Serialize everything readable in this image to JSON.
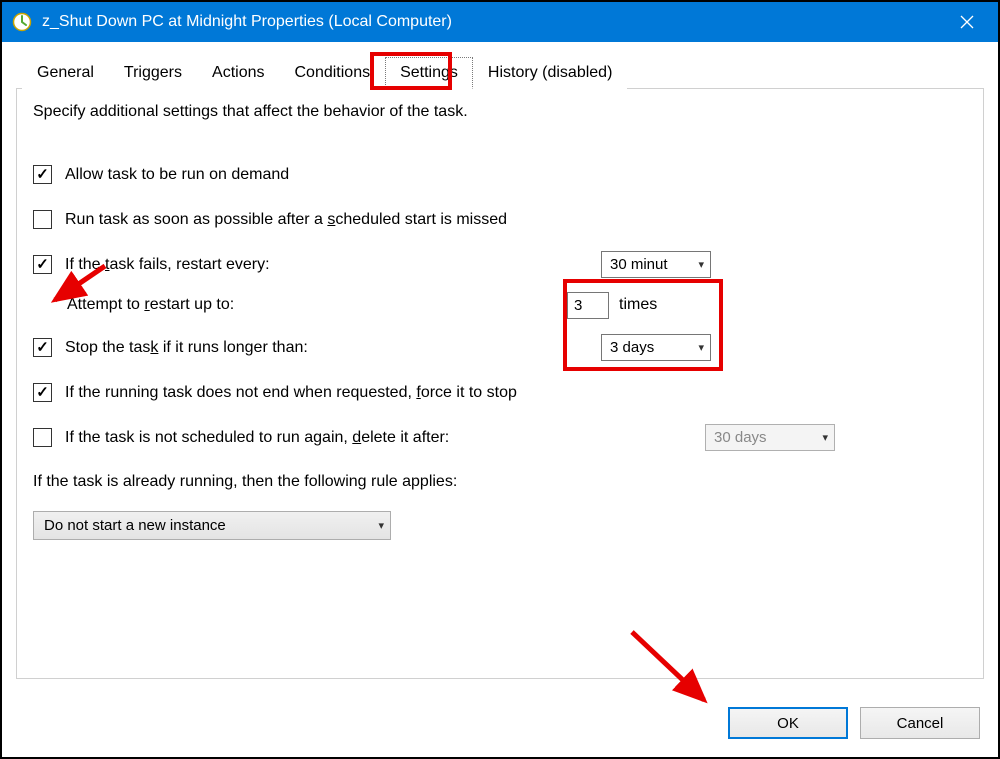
{
  "window": {
    "title": "z_Shut Down PC at Midnight Properties (Local Computer)"
  },
  "tabs": {
    "general": "General",
    "triggers": "Triggers",
    "actions": "Actions",
    "conditions": "Conditions",
    "settings": "Settings",
    "history": "History (disabled)"
  },
  "content": {
    "intro": "Specify additional settings that affect the behavior of the task.",
    "allow_demand": "Allow task to be run on demand",
    "run_missed_pre": "Run task as soon as possible after a ",
    "run_missed_ul": "s",
    "run_missed_post": "cheduled start is missed",
    "restart_pre": "If the ",
    "restart_ul": "t",
    "restart_post": "ask fails, restart every:",
    "restart_interval": "30 minut",
    "attempt_pre": "Attempt to ",
    "attempt_ul": "r",
    "attempt_post": "estart up to:",
    "attempt_count": "3",
    "times": "times",
    "stop_pre": "Stop the tas",
    "stop_ul": "k",
    "stop_post": " if it runs longer than:",
    "stop_duration": "3 days",
    "force_pre": "If the running task does not end when requested, ",
    "force_ul": "f",
    "force_post": "orce it to stop",
    "delete_pre": "If the task is not scheduled to run again, ",
    "delete_ul": "d",
    "delete_post": "elete it after:",
    "delete_duration": "30 days",
    "rule_pre": "If the task is already ru",
    "rule_ul": "n",
    "rule_post": "ning, then the following rule applies:",
    "rule_selected": "Do not start a new instance"
  },
  "buttons": {
    "ok": "OK",
    "cancel": "Cancel"
  }
}
